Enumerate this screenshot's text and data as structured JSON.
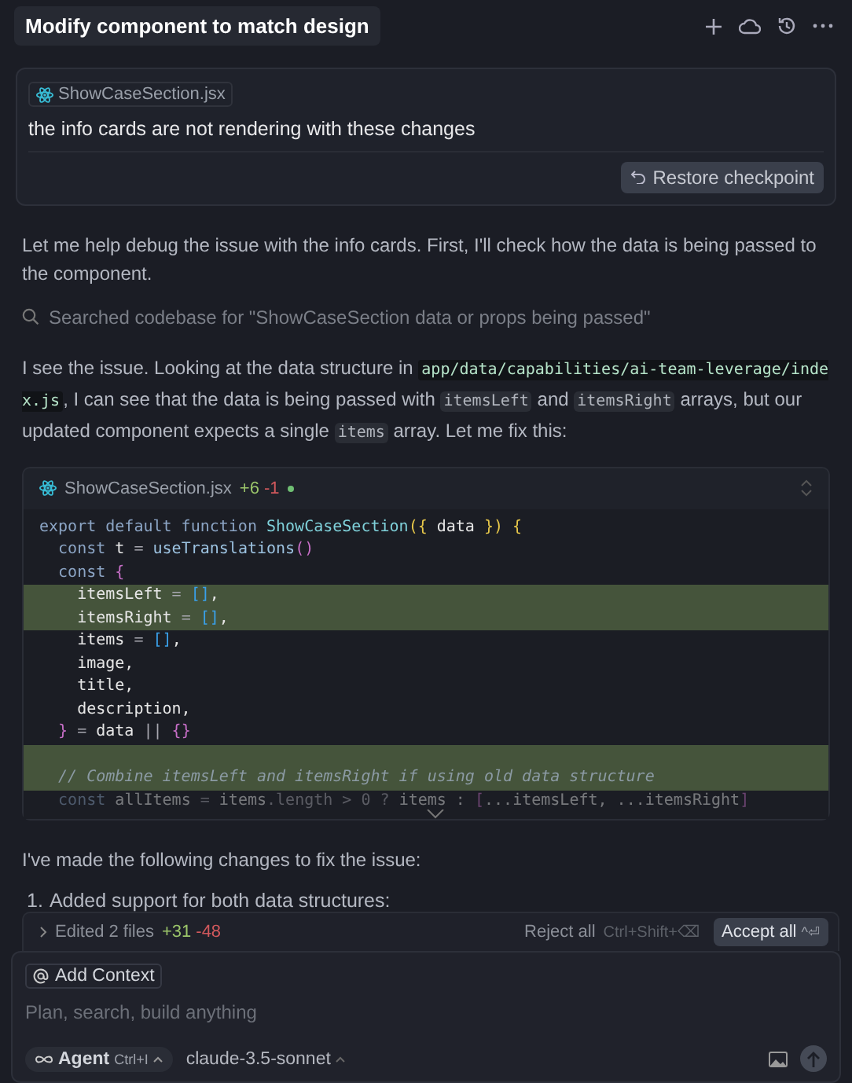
{
  "header": {
    "title": "Modify component to match design"
  },
  "user_message": {
    "file_chip": "ShowCaseSection.jsx",
    "text": "the info cards are not rendering with these changes",
    "restore_button": "Restore checkpoint"
  },
  "intro": "Let me help debug the issue with the info cards. First, I'll check how the data is being passed to the component.",
  "search_step": "Searched codebase for \"ShowCaseSection data or props being passed\"",
  "explanation": [
    {
      "kind": "text",
      "text": "I see the issue. Looking at the data structure in "
    },
    {
      "kind": "path",
      "text": "app/data/capabilities/ai-team-leverage/index.js"
    },
    {
      "kind": "text",
      "text": ", I can see that the data is being passed with "
    },
    {
      "kind": "code",
      "text": "itemsLeft"
    },
    {
      "kind": "text",
      "text": " and "
    },
    {
      "kind": "code",
      "text": "itemsRight"
    },
    {
      "kind": "text",
      "text": " arrays, but our updated component expects a single "
    },
    {
      "kind": "code",
      "text": "items"
    },
    {
      "kind": "text",
      "text": " array. Let me fix this:"
    }
  ],
  "code_block": {
    "file": "ShowCaseSection.jsx",
    "added": "+6",
    "removed": "-1",
    "lines": [
      {
        "added": false,
        "faded": false,
        "tokens": [
          {
            "t": "export default function ",
            "kind": "kw"
          },
          {
            "t": "ShowCaseSection",
            "kind": "fn"
          },
          {
            "t": "({ ",
            "kind": "y"
          },
          {
            "t": "data ",
            "kind": "id"
          },
          {
            "t": "}) {",
            "kind": "y"
          }
        ]
      },
      {
        "added": false,
        "faded": false,
        "tokens": [
          {
            "t": "  const ",
            "kind": "kw"
          },
          {
            "t": "t ",
            "kind": "id"
          },
          {
            "t": "= ",
            "kind": "op"
          },
          {
            "t": "useTranslations",
            "kind": "fn2"
          },
          {
            "t": "()",
            "kind": "p"
          }
        ]
      },
      {
        "added": false,
        "faded": false,
        "tokens": [
          {
            "t": "  const ",
            "kind": "kw"
          },
          {
            "t": "{",
            "kind": "p"
          }
        ]
      },
      {
        "added": true,
        "faded": false,
        "tokens": [
          {
            "t": "    itemsLeft ",
            "kind": "id"
          },
          {
            "t": "= ",
            "kind": "op"
          },
          {
            "t": "[]",
            "kind": "b"
          },
          {
            "t": ",",
            "kind": "id"
          }
        ]
      },
      {
        "added": true,
        "faded": false,
        "tokens": [
          {
            "t": "    itemsRight ",
            "kind": "id"
          },
          {
            "t": "= ",
            "kind": "op"
          },
          {
            "t": "[]",
            "kind": "b"
          },
          {
            "t": ",",
            "kind": "id"
          }
        ]
      },
      {
        "added": false,
        "faded": false,
        "tokens": [
          {
            "t": "    items ",
            "kind": "id"
          },
          {
            "t": "= ",
            "kind": "op"
          },
          {
            "t": "[]",
            "kind": "b"
          },
          {
            "t": ",",
            "kind": "id"
          }
        ]
      },
      {
        "added": false,
        "faded": false,
        "tokens": [
          {
            "t": "    image,",
            "kind": "id"
          }
        ]
      },
      {
        "added": false,
        "faded": false,
        "tokens": [
          {
            "t": "    title,",
            "kind": "id"
          }
        ]
      },
      {
        "added": false,
        "faded": false,
        "tokens": [
          {
            "t": "    description,",
            "kind": "id"
          }
        ]
      },
      {
        "added": false,
        "faded": false,
        "tokens": [
          {
            "t": "  }",
            "kind": "p"
          },
          {
            "t": " = ",
            "kind": "op"
          },
          {
            "t": "data ",
            "kind": "id"
          },
          {
            "t": "|| ",
            "kind": "op"
          },
          {
            "t": "{}",
            "kind": "p"
          }
        ]
      },
      {
        "added": true,
        "faded": false
      },
      {
        "added": true,
        "faded": false,
        "tokens": [
          {
            "t": "  // Combine itemsLeft and itemsRight if using old data structure",
            "kind": "cm"
          }
        ]
      },
      {
        "added": false,
        "faded": true,
        "tokens": [
          {
            "t": "  const ",
            "kind": "kw"
          },
          {
            "t": "allItems ",
            "kind": "id"
          },
          {
            "t": "= ",
            "kind": "op"
          },
          {
            "t": "items",
            "kind": "id"
          },
          {
            "t": ".length > 0 ? ",
            "kind": "op"
          },
          {
            "t": "items : ",
            "kind": "id"
          },
          {
            "t": "[",
            "kind": "p"
          },
          {
            "t": "...itemsLeft, ...itemsRight",
            "kind": "id"
          },
          {
            "t": "]",
            "kind": "p"
          }
        ]
      }
    ]
  },
  "summary": "I've made the following changes to fix the issue:",
  "list": [
    {
      "number": "1.",
      "text": "Added support for both data structures:"
    }
  ],
  "edits_bar": {
    "label": "Edited 2 files",
    "added": "+31",
    "removed": "-48",
    "reject": "Reject all",
    "reject_shortcut": "Ctrl+Shift+⌫",
    "accept": "Accept all",
    "accept_shortcut": "^⏎"
  },
  "composer": {
    "context_button": "Add Context",
    "placeholder": "Plan, search, build anything",
    "mode": "Agent",
    "mode_shortcut": "Ctrl+I",
    "model": "claude-3.5-sonnet"
  }
}
